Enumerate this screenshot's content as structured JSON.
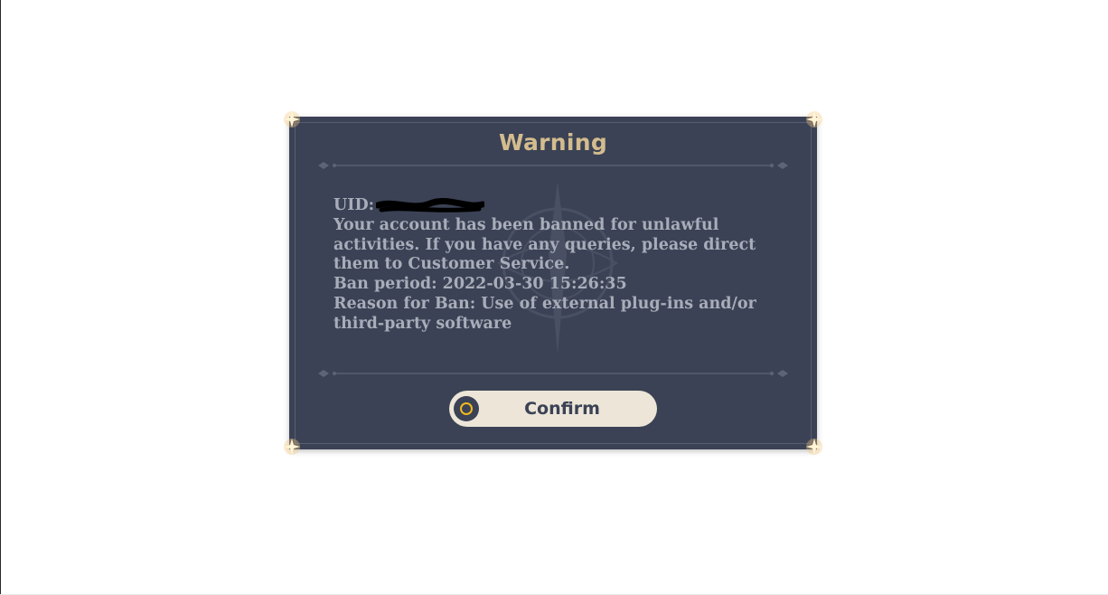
{
  "dialog": {
    "title": "Warning",
    "uid_label": "UID:",
    "message_lines": [
      "Your account has been banned for unlawful",
      "activities. If you have any queries, please direct",
      "them to Customer Service.",
      "Ban period: 2022-03-30 15:26:35",
      "Reason for Ban: Use of external plug-ins and/or",
      "third-party software"
    ],
    "confirm_label": "Confirm",
    "confirm_icon": "circle-icon"
  },
  "colors": {
    "dialog_bg": "#3b4255",
    "title": "#d3bc8e",
    "body_text": "#a8adb9",
    "button_bg": "#ece5d8",
    "button_icon_ring": "#f0b91d",
    "corner_glow": "#f5d08a"
  }
}
